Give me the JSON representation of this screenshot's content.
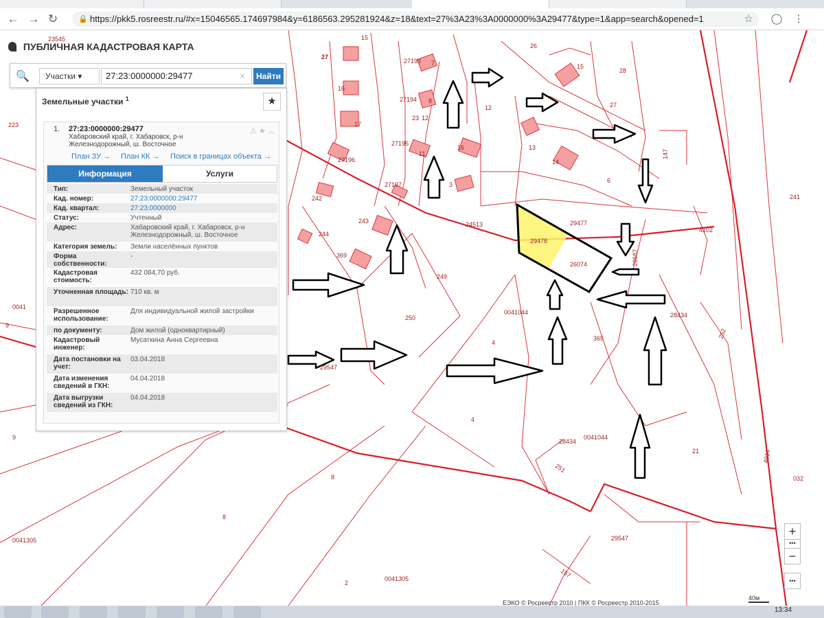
{
  "browser": {
    "url": "https://pkk5.rosreestr.ru/#x=15046565.174697984&y=6186563.295281924&z=18&text=27%3A23%3A0000000%3A29477&type=1&app=search&opened=1",
    "back_icon": "back-arrow-icon",
    "forward_icon": "forward-arrow-icon",
    "reload_icon": "reload-icon"
  },
  "app": {
    "title": "ПУБЛИЧНАЯ КАДАСТРОВАЯ КАРТА"
  },
  "search": {
    "type_label": "Участки",
    "query": "27:23:0000000:29477",
    "button_label": "Найти"
  },
  "panel": {
    "title": "Земельные участки",
    "count": "1",
    "item_index": "1.",
    "cad_number": "27:23:0000000:29477",
    "address_short": "Хабаровский край, г. Хабаровск, р-н Железнодорожный, ш. Восточное",
    "links": [
      "План ЗУ →",
      "План КК →",
      "Поиск в границах объекта →"
    ],
    "tabs": [
      "Информация",
      "Услуги"
    ],
    "rows": [
      {
        "k": "Тип:",
        "v": "Земельный участок"
      },
      {
        "k": "Кад. номер:",
        "v": "27:23:0000000:29477"
      },
      {
        "k": "Кад. квартал:",
        "v": "27:23:0000000"
      },
      {
        "k": "Статус:",
        "v": "Учтенный"
      },
      {
        "k": "Адрес:",
        "v": "Хабаровский край, г. Хабаровск, р-н Железнодорожный, ш. Восточное"
      },
      {
        "k": "Категория земель:",
        "v": "Земли населённых пунктов"
      },
      {
        "k": "Форма собственности:",
        "v": "-"
      },
      {
        "k": "Кадастровая стоимость:",
        "v": "432 084,70 руб."
      },
      {
        "k": "Уточненная площадь:",
        "v": "710 кв. м"
      },
      {
        "k": "Разрешенное использование:",
        "v": "Для индивидуальной жилой застройки"
      },
      {
        "k": "по документу:",
        "v": "Дом жилой (одноквартирный)"
      },
      {
        "k": "Кадастровый инженер:",
        "v": "Мусаткина Анна Сергеевна"
      },
      {
        "k": "Дата постановки на учет:",
        "v": "03.04.2018"
      },
      {
        "k": "Дата изменения сведений в ГКН:",
        "v": "04.04.2018"
      },
      {
        "k": "Дата выгрузки сведений из ГКН:",
        "v": "04.04.2018"
      }
    ]
  },
  "map": {
    "labels": [
      "23545",
      "15",
      "27",
      "23",
      "27193",
      "7",
      "26",
      "15",
      "28",
      "16",
      "12",
      "27194",
      "8",
      "12",
      "27",
      "17",
      "27195",
      "11",
      "16",
      "13",
      "14",
      "223",
      "27196",
      "27197",
      "3",
      "6",
      "147",
      "241",
      "242",
      "243",
      "244",
      "369",
      "24513",
      "29477",
      "29478",
      "26074",
      "28687",
      "4102",
      "249",
      "250",
      "0041044",
      "28434",
      "4",
      "365",
      "252",
      "29547",
      "4",
      "28434",
      "0041044",
      "21",
      "251",
      "8",
      "0041305",
      "8",
      "2",
      "0041305",
      "29547",
      "157",
      "0041",
      "9",
      "9",
      "032",
      "4914"
    ],
    "highlight": "29477"
  },
  "controls": {
    "zoom_in": "+",
    "more": "•••",
    "zoom_out": "−",
    "menu": "•••"
  },
  "attribution": "ЕЭКО © Росреестр 2010 | ПКК © Росреестр 2010-2015",
  "scale": "40м",
  "taskbar": {
    "time": "13:34"
  }
}
